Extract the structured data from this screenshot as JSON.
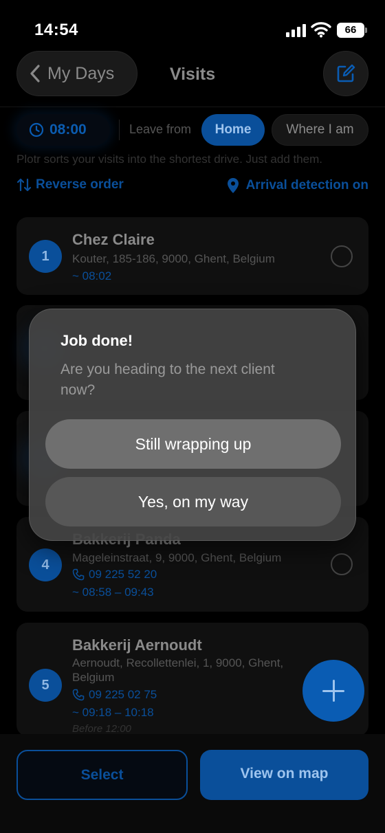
{
  "status_bar": {
    "time": "14:54",
    "battery": "66"
  },
  "nav": {
    "back_label": "My Days",
    "title": "Visits"
  },
  "filters": {
    "start_time": "08:00",
    "leave_from_label": "Leave from",
    "home_label": "Home",
    "where_label": "Where I am"
  },
  "hint": "Plotr sorts your visits into the shortest drive. Just add them.",
  "actions": {
    "reverse_label": "Reverse order",
    "arrival_label": "Arrival detection on"
  },
  "visits": [
    {
      "number": "1",
      "name": "Chez Claire",
      "address": "Kouter, 185-186, 9000, Ghent, Belgium",
      "eta": "~ 08:02"
    },
    {
      "number": "4",
      "name": "Bakkerij Panda",
      "address": "Mageleinstraat, 9, 9000, Ghent, Belgium",
      "phone": "09 225 52 20",
      "eta": "~ 08:58 – 09:43"
    },
    {
      "number": "5",
      "name": "Bakkerij Aernoudt",
      "address": "Aernoudt, Recollettenlei, 1, 9000, Ghent, Belgium",
      "phone": "09 225 02 75",
      "eta": "~ 09:18 – 10:18",
      "note": "Before 12:00"
    }
  ],
  "dialog": {
    "title": "Job done!",
    "message": "Are you heading to the next client now?",
    "primary_label": "Still wrapping up",
    "secondary_label": "Yes, on my way"
  },
  "bottom": {
    "select_label": "Select",
    "map_label": "View on map"
  },
  "colors": {
    "accent": "#0a5cb3",
    "background": "#000000",
    "card": "#101010",
    "dialog": "#444444"
  }
}
